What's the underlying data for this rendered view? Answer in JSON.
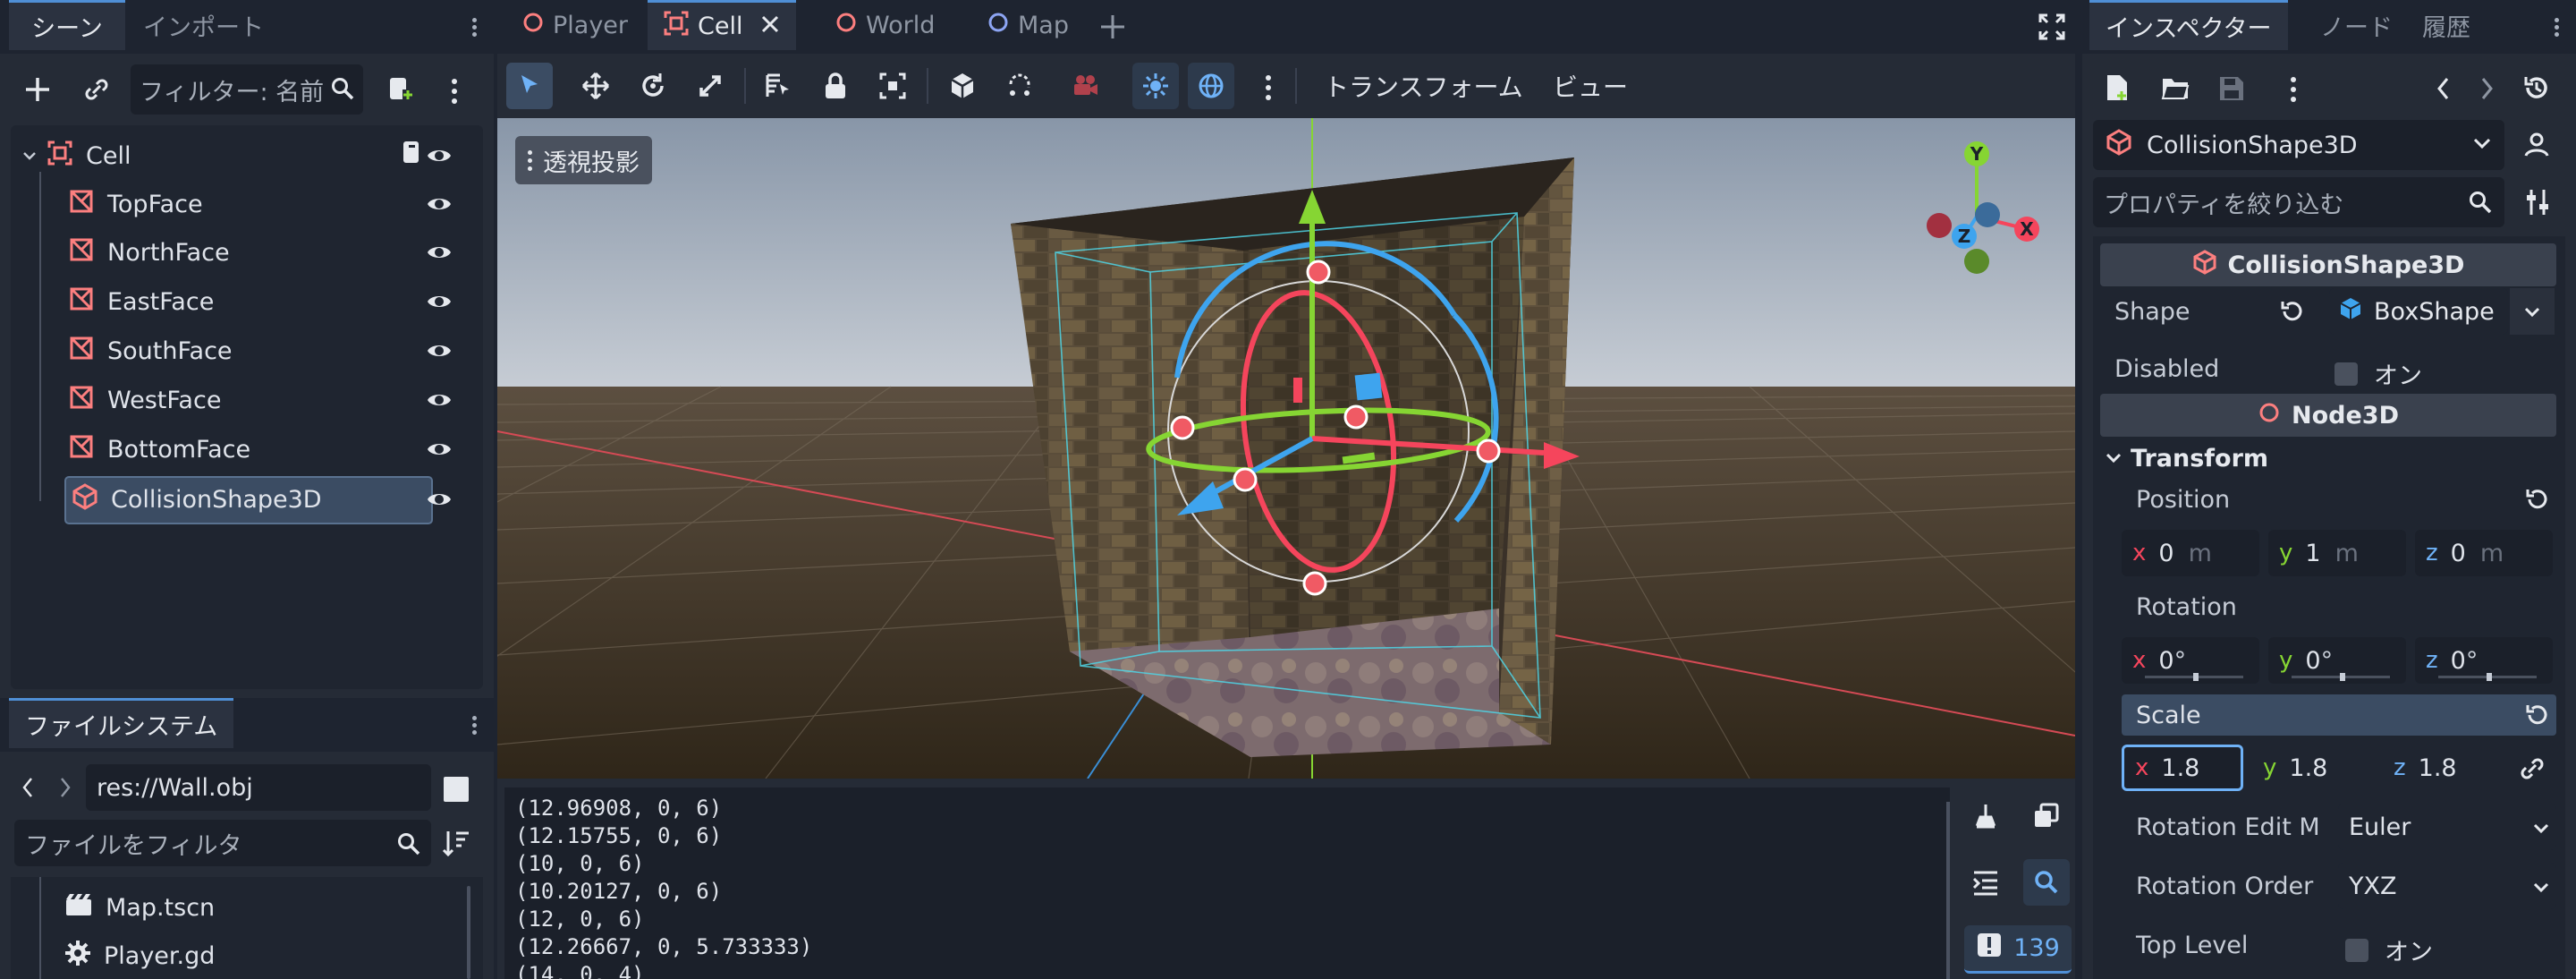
{
  "left_dock": {
    "tabs": [
      "シーン",
      "インポート"
    ],
    "filter_placeholder": "フィルター: 名前",
    "tree": [
      {
        "label": "Cell"
      },
      {
        "label": "TopFace"
      },
      {
        "label": "NorthFace"
      },
      {
        "label": "EastFace"
      },
      {
        "label": "SouthFace"
      },
      {
        "label": "WestFace"
      },
      {
        "label": "BottomFace"
      },
      {
        "label": "CollisionShape3D"
      }
    ]
  },
  "filesystem": {
    "tab": "ファイルシステム",
    "path": "res://Wall.obj",
    "filter_placeholder": "ファイルをフィルタ",
    "items": [
      {
        "label": "Map.tscn"
      },
      {
        "label": "Player.gd"
      }
    ]
  },
  "editor_tabs": [
    {
      "label": "Player"
    },
    {
      "label": "Cell"
    },
    {
      "label": "World"
    },
    {
      "label": "Map"
    }
  ],
  "toolbar": {
    "transform_menu": "トランスフォーム",
    "view_menu": "ビュー"
  },
  "viewport": {
    "perspective_label": "透視投影",
    "gizmo_axes": {
      "x": "X",
      "y": "Y",
      "z": "Z"
    }
  },
  "console": {
    "lines": [
      "(12.96908, 0, 6)",
      "(12.15755, 0, 6)",
      "(10, 0, 6)",
      "(10.20127, 0, 6)",
      "(12, 0, 6)",
      "(12.26667, 0, 5.733333)",
      "(14, 0, 4)"
    ],
    "message_count": "139"
  },
  "inspector": {
    "tabs": [
      "インスペクター",
      "ノード",
      "履歴"
    ],
    "object_name": "CollisionShape3D",
    "filter_placeholder": "プロパティを絞り込む",
    "section_title": "CollisionShape3D",
    "shape_label": "Shape",
    "shape_value": "BoxShape",
    "disabled_label": "Disabled",
    "disabled_value": "オン",
    "node3d_title": "Node3D",
    "transform_label": "Transform",
    "position_label": "Position",
    "position": {
      "x": "0",
      "y": "1",
      "z": "0",
      "unit": "m"
    },
    "rotation_label": "Rotation",
    "rotation": {
      "x": "0",
      "y": "0",
      "z": "0",
      "unit": "°"
    },
    "scale_label": "Scale",
    "scale": {
      "x": "1.8",
      "y": "1.8",
      "z": "1.8"
    },
    "rotation_edit_mode_label": "Rotation Edit M",
    "rotation_edit_mode_value": "Euler",
    "rotation_order_label": "Rotation Order",
    "rotation_order_value": "YXZ",
    "top_level_label": "Top Level",
    "top_level_value": "オン"
  },
  "colors": {
    "accent": "#4f8fd6",
    "node_icon": "#fc7f7f",
    "axis_x": "#f5455c",
    "axis_y": "#86d533",
    "axis_z": "#3ea4ee"
  }
}
